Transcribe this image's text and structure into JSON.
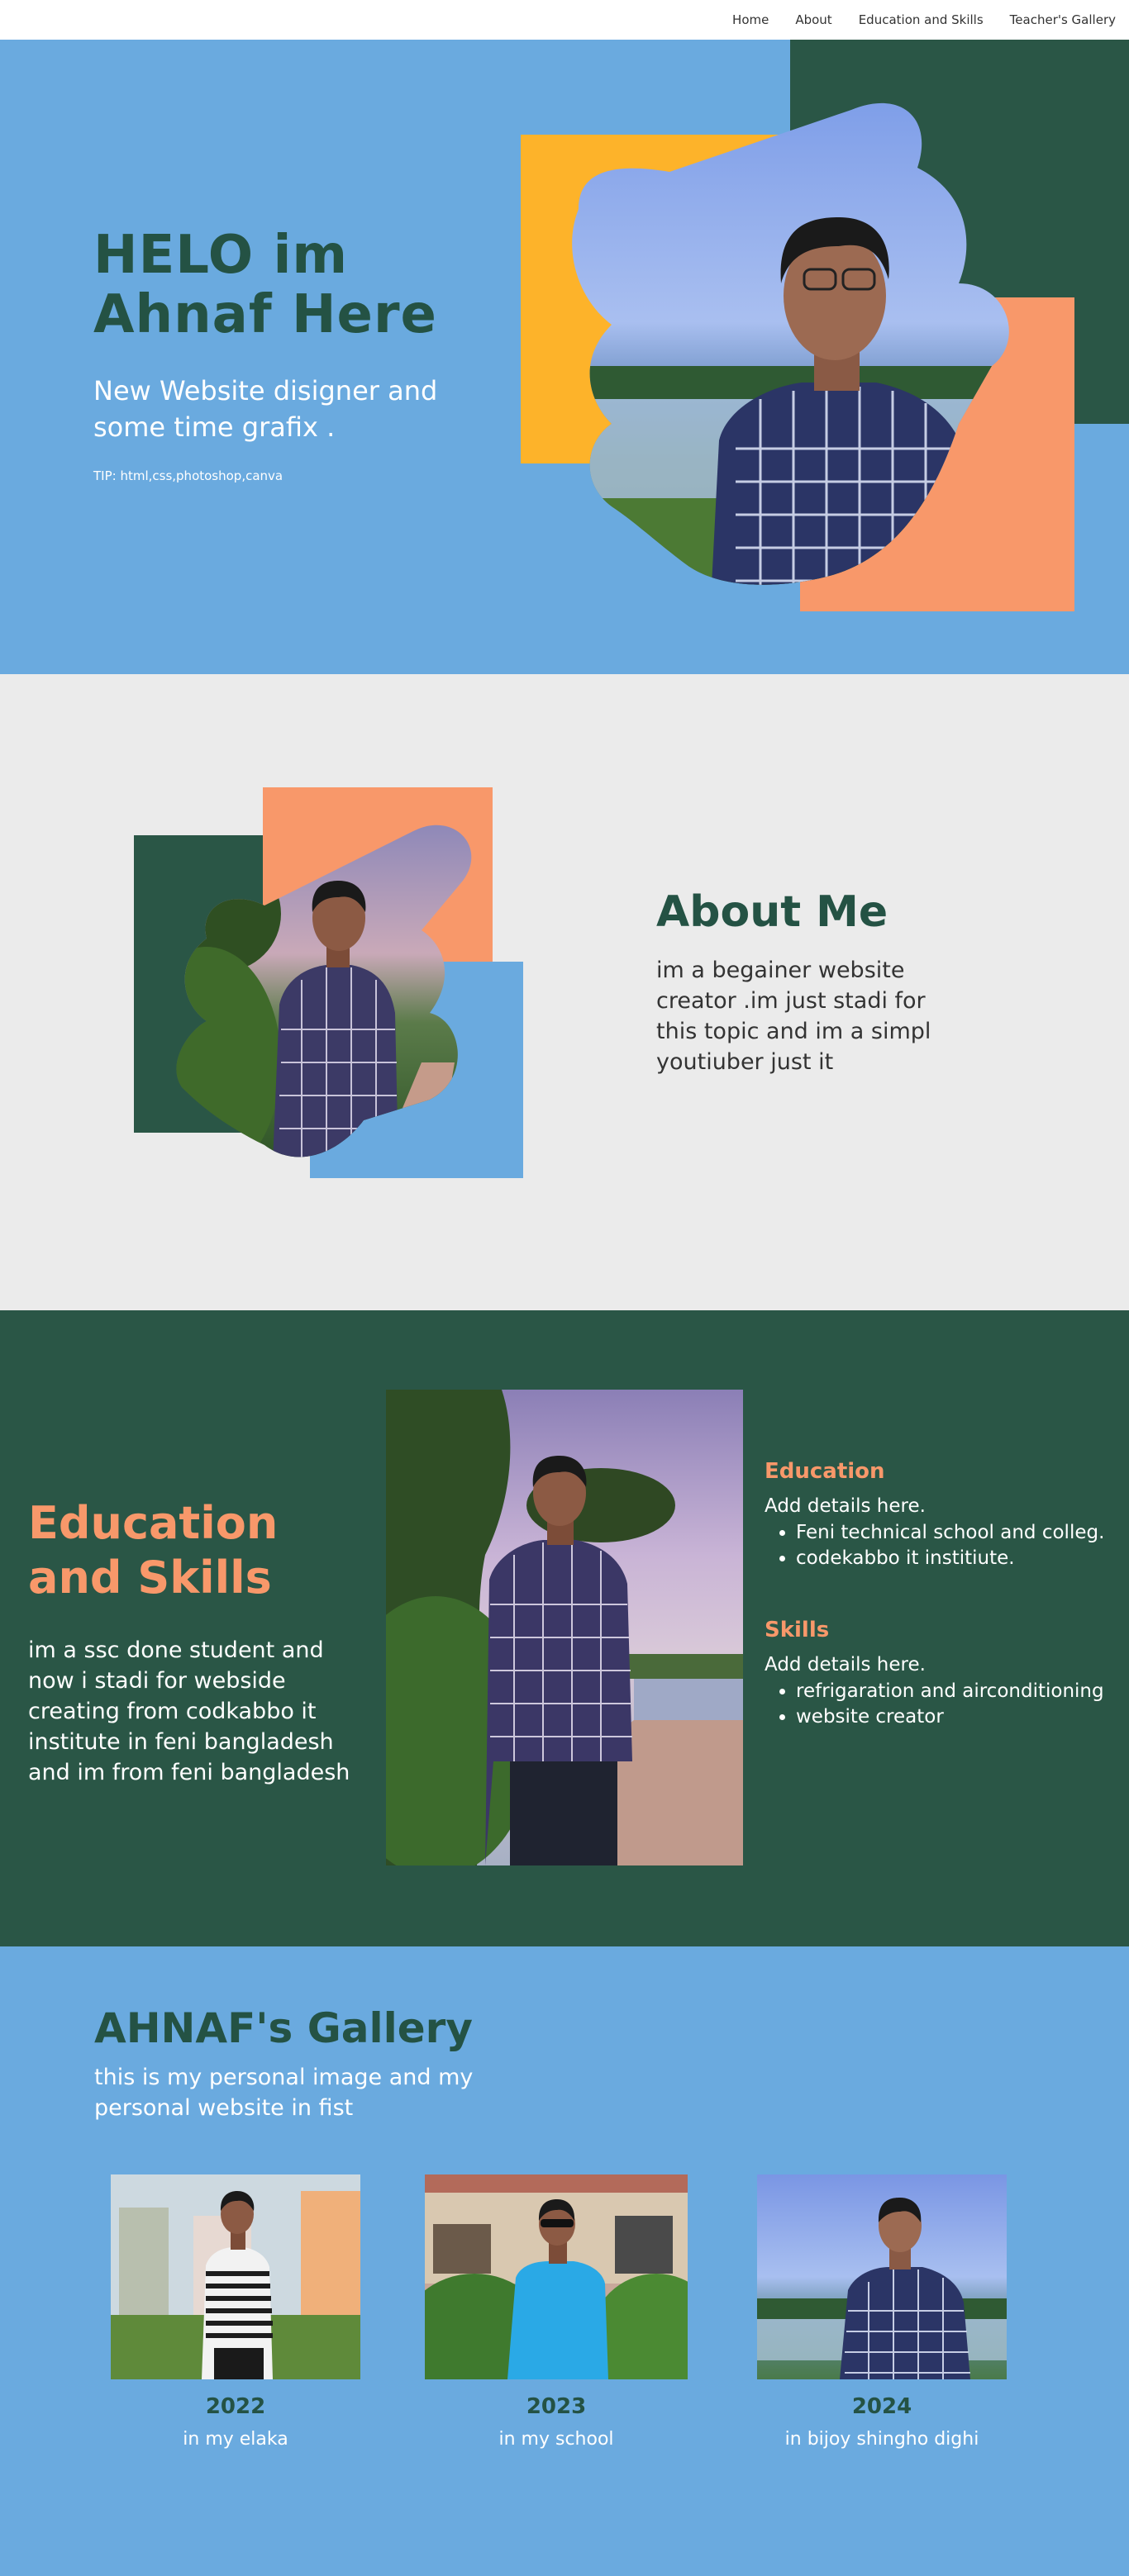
{
  "nav": {
    "items": [
      "Home",
      "About",
      "Education and Skills",
      "Teacher's Gallery"
    ]
  },
  "hero": {
    "title_line1": "HELO im",
    "title_line2": "Ahnaf Here",
    "subtitle": "New Website disigner and some time grafix .",
    "tip": "TIP: html,css,photoshop,canva"
  },
  "about": {
    "title": "About Me",
    "description": "im a begainer website creator .im just stadi for this topic and im a simpl youtiuber just it"
  },
  "education": {
    "title_line1": "Education",
    "title_line2": "and Skills",
    "description": "im a ssc done student and now i stadi for webside creating from codkabbo it institute in feni bangladesh and im from feni bangladesh",
    "edu_heading": "Education",
    "edu_intro": "Add details here.",
    "edu_items": [
      "Feni technical school and colleg.",
      "codekabbo it institiute."
    ],
    "skills_heading": "Skills",
    "skills_intro": "Add details here.",
    "skills_items": [
      "refrigaration and airconditioning",
      "website creator"
    ]
  },
  "gallery": {
    "title": "AHNAF's Gallery",
    "description": "this is my personal image and my personal website in fist",
    "cards": [
      {
        "year": "2022",
        "caption": "in my elaka"
      },
      {
        "year": "2023",
        "caption": "in my school"
      },
      {
        "year": "2024",
        "caption": "in bijoy shingho dighi"
      }
    ]
  },
  "colors": {
    "blue": "#6aaadf",
    "dark_green": "#2a5646",
    "heading_green": "#245244",
    "orange": "#f8986a",
    "yellow": "#fdb32a",
    "light_gray": "#ebebeb"
  }
}
